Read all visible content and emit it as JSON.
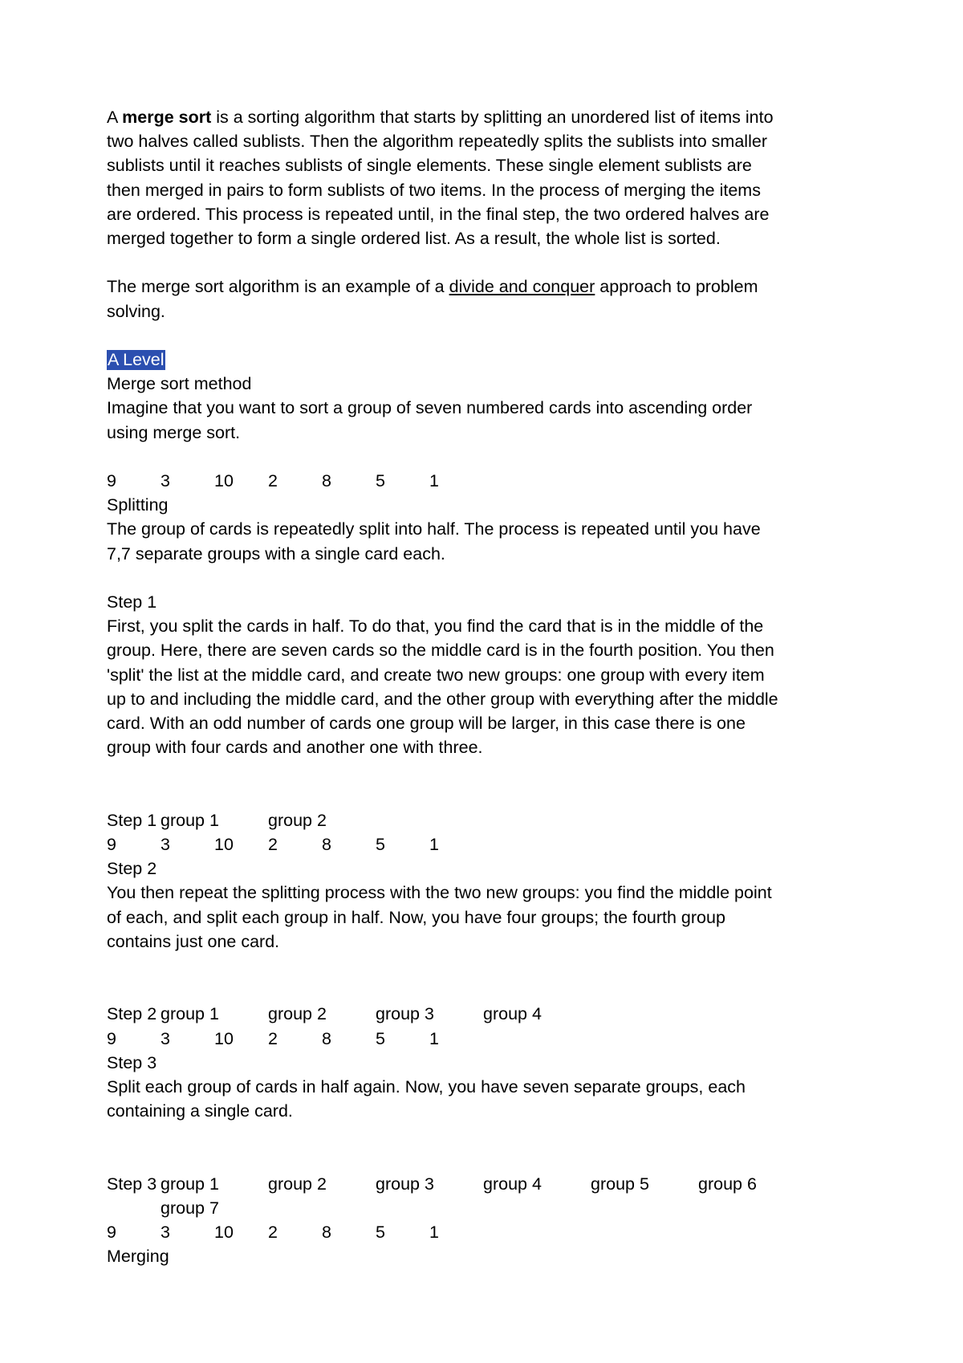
{
  "document": {
    "paragraphs": {
      "intro_lead": "A ",
      "intro_bold": "merge sort",
      "intro_rest": " is a sorting algorithm that starts by splitting an unordered list of items into two halves called sublists. Then the algorithm repeatedly splits the sublists into smaller sublists until it reaches sublists of single elements. These single element sublists are then merged in pairs to form sublists of two items. In the process of merging the items are ordered. This process is repeated until, in the final step, the two ordered halves are merged together to form a single ordered list. As a result, the whole list is sorted.",
      "divide_lead": "The merge sort algorithm is an example of a ",
      "divide_link": "divide and conquer",
      "divide_rest": " approach to problem solving.",
      "a_level_heading": "A Level",
      "merge_sort_method": "Merge sort method",
      "imagine": "Imagine that you want to sort a group of seven numbered cards into ascending order using merge sort.",
      "splitting_heading": "Splitting",
      "splitting_body": "The group of cards is repeatedly split into half. The process is repeated until you have 7,7 separate groups with a single card each.",
      "step1_heading": "Step 1",
      "step1_body": "First, you split the cards in half. To do that, you find the card that is in the middle of the group. Here, there are seven cards so the middle card is in the fourth position. You then 'split' the list at the middle card, and create two new groups: one group with every item up to and including the middle card, and the other group with everything after the middle card. With an odd number of cards one group will be larger, in this case there is one group with four cards and another one with three.",
      "step2_heading": "Step 2",
      "step2_body": "You then repeat the splitting process with the two new groups: you find the middle point of each, and split each group in half. Now, you have four groups; the fourth group contains just one card.",
      "step3_heading": "Step 3",
      "step3_body": "Split each group of cards in half again. Now, you have seven separate groups, each containing a single card.",
      "merging_heading": "Merging"
    },
    "cards": {
      "initial": [
        "9",
        "3",
        "10",
        "2",
        "8",
        "5",
        "1"
      ]
    },
    "step1_table": {
      "step_label": "Step 1",
      "groups": [
        "group 1",
        "group 2"
      ],
      "cards": [
        "9",
        "3",
        "10",
        "2",
        "8",
        "5",
        "1"
      ]
    },
    "step2_table": {
      "step_label": "Step 2",
      "groups": [
        "group 1",
        "group 2",
        "group 3",
        "group 4"
      ],
      "cards": [
        "9",
        "3",
        "10",
        "2",
        "8",
        "5",
        "1"
      ]
    },
    "step3_table": {
      "step_label": "Step 3",
      "groups": [
        "group 1",
        "group 2",
        "group 3",
        "group 4",
        "group 5",
        "group 6",
        "group 7"
      ],
      "cards": [
        "9",
        "3",
        "10",
        "2",
        "8",
        "5",
        "1"
      ]
    },
    "colors": {
      "selection_background": "#2c4fb0",
      "selection_text": "#ffffff",
      "body_text": "#000000",
      "page_background": "#ffffff"
    }
  }
}
